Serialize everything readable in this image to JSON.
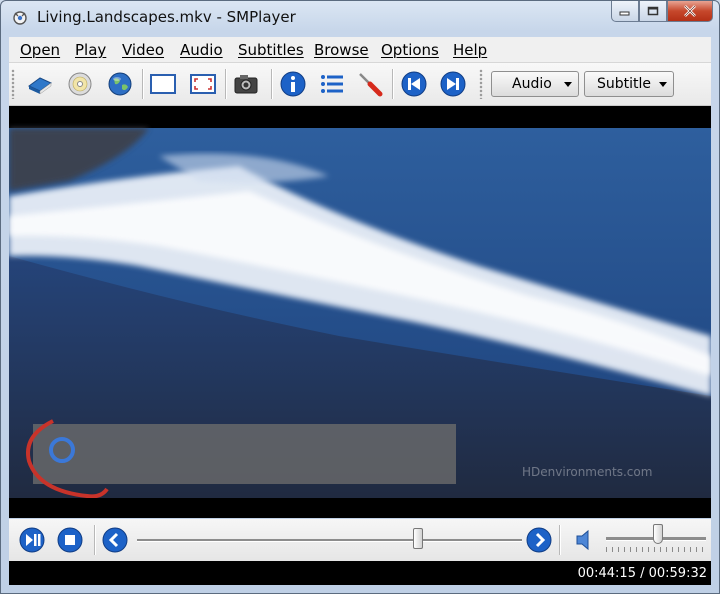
{
  "window": {
    "title": "Living.Landscapes.mkv - SMPlayer"
  },
  "menu": [
    "Open",
    "Play",
    "Video",
    "Audio",
    "Subtitles",
    "Browse",
    "Options",
    "Help"
  ],
  "toolbar": {
    "buttons": [
      "open-file",
      "open-disc",
      "open-url",
      "compact-view",
      "fullscreen",
      "screenshot",
      "info",
      "playlist",
      "preferences",
      "previous",
      "next"
    ],
    "audio_label": "Audio",
    "subtitle_label": "Subtitle"
  },
  "video": {
    "watermark": "HDenvironments.com"
  },
  "controls": {
    "seek_fraction": 0.73,
    "volume_fraction": 0.52
  },
  "status": {
    "time": "00:44:15 / 00:59:32"
  },
  "colors": {
    "accent_blue": "#1d62c7",
    "video_bg": "#000000",
    "close_red": "#c6482c"
  }
}
